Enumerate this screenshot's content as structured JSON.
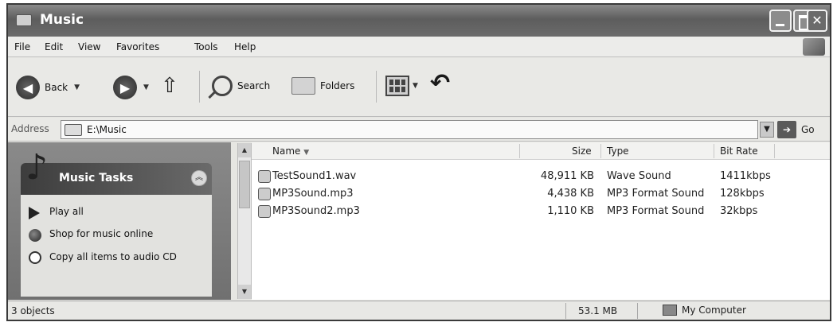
{
  "window": {
    "title": "Music"
  },
  "menu": [
    "File",
    "Edit",
    "View",
    "Favorites",
    "Tools",
    "Help"
  ],
  "toolbar": {
    "back_label": "Back",
    "search_label": "Search",
    "folders_label": "Folders"
  },
  "address": {
    "label": "Address",
    "value": "E:\\Music",
    "go_label": "Go"
  },
  "tasks": {
    "title": "Music Tasks",
    "items": [
      {
        "label": "Play all",
        "icon": "play-icon"
      },
      {
        "label": "Shop for music online",
        "icon": "globe-icon"
      },
      {
        "label": "Copy all items to audio CD",
        "icon": "cd-icon"
      }
    ]
  },
  "columns": {
    "name": "Name",
    "size": "Size",
    "type": "Type",
    "bitrate": "Bit Rate"
  },
  "files": [
    {
      "name": "TestSound1.wav",
      "size": "48,911 KB",
      "type": "Wave Sound",
      "bitrate": "1411kbps"
    },
    {
      "name": "MP3Sound.mp3",
      "size": "4,438 KB",
      "type": "MP3 Format Sound",
      "bitrate": "128kbps"
    },
    {
      "name": "MP3Sound2.mp3",
      "size": "1,110 KB",
      "type": "MP3 Format Sound",
      "bitrate": "32kbps"
    }
  ],
  "status": {
    "count": "3 objects",
    "size": "53.1 MB",
    "location": "My Computer"
  }
}
